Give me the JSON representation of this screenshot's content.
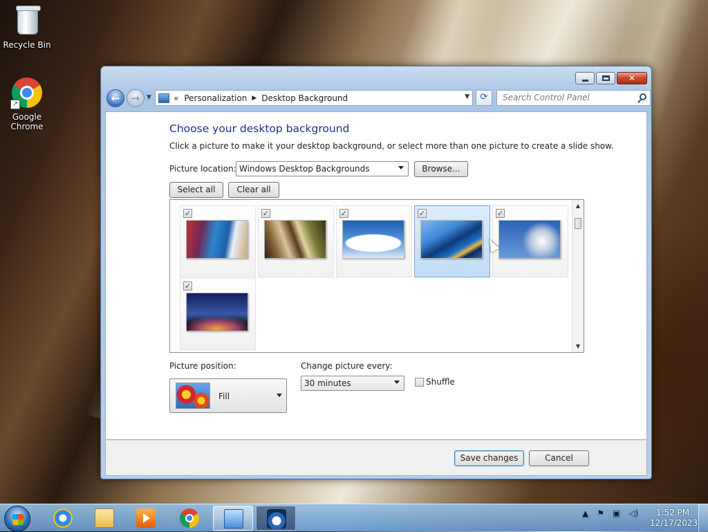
{
  "desktop": {
    "icons": [
      {
        "label": "Recycle Bin"
      },
      {
        "label": "Google Chrome"
      }
    ]
  },
  "window": {
    "address": {
      "crumbs": [
        "Personalization",
        "Desktop Background"
      ],
      "overflow": "«"
    },
    "search": {
      "placeholder": "Search Control Panel"
    },
    "heading": "Choose your desktop background",
    "description": "Click a picture to make it your desktop background, or select more than one picture to create a slide show.",
    "picture_location": {
      "label": "Picture location:",
      "value": "Windows Desktop Backgrounds",
      "browse_label": "Browse..."
    },
    "select_all_label": "Select all",
    "clear_all_label": "Clear all",
    "gallery": {
      "images": [
        {
          "checked": true,
          "selected": false
        },
        {
          "checked": true,
          "selected": false
        },
        {
          "checked": true,
          "selected": false
        },
        {
          "checked": true,
          "selected": true
        },
        {
          "checked": true,
          "selected": false
        },
        {
          "checked": true,
          "selected": false
        }
      ]
    },
    "picture_position": {
      "label": "Picture position:",
      "value": "Fill"
    },
    "change_picture": {
      "label": "Change picture every:",
      "value": "30 minutes"
    },
    "shuffle": {
      "label": "Shuffle",
      "checked": false
    },
    "save_label": "Save changes",
    "cancel_label": "Cancel"
  },
  "taskbar": {
    "clock_time": "1:52 PM",
    "clock_date": "12/17/2023"
  },
  "colors": {
    "heading": "#1e3287",
    "selection": "#c3dcf5",
    "taskbar": "#7aa6d4"
  }
}
